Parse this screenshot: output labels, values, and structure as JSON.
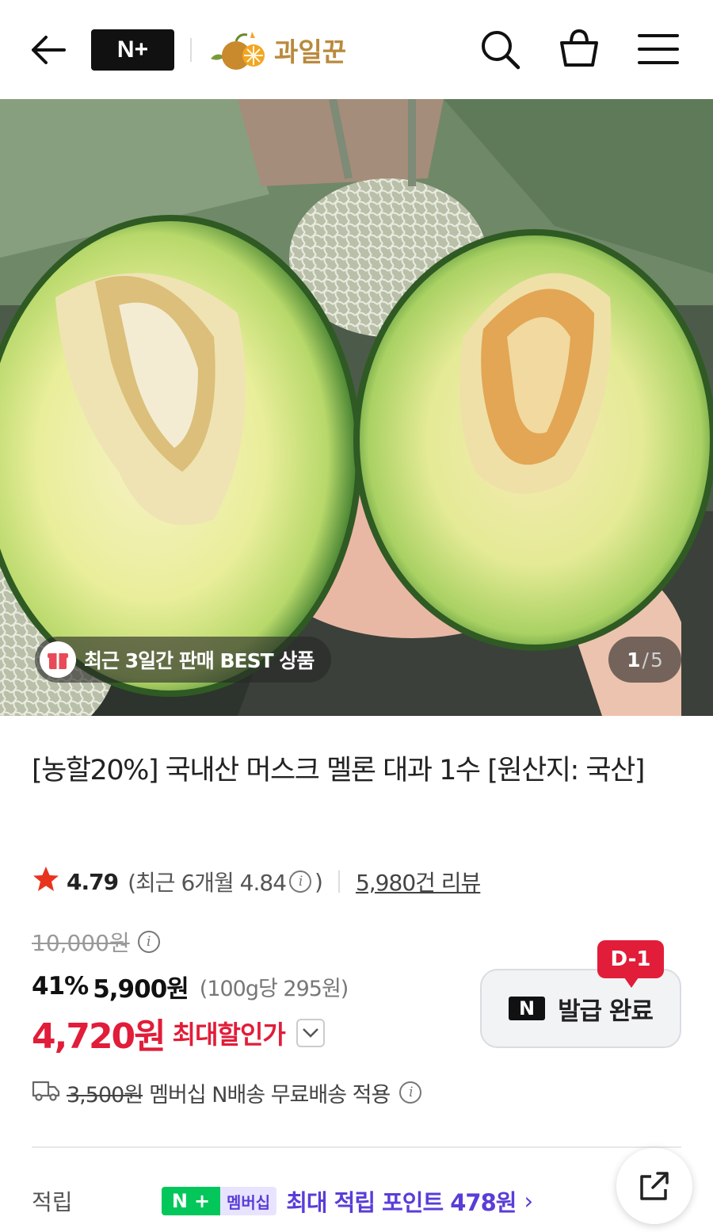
{
  "header": {
    "brand_badge": "N+",
    "store_name": "과일꾼"
  },
  "hero": {
    "badge_text": "최근 3일간 판매 BEST 상품",
    "page_current": "1",
    "page_sep": "/",
    "page_total": "5"
  },
  "product": {
    "title": "[농할20%] 국내산 머스크 멜론 대과 1수 [원산지: 국산]",
    "rating": "4.79",
    "recent_rating_label": "(최근 6개월 4.84",
    "recent_rating_close": ")",
    "review_count": "5,980건 리뷰",
    "original_price": "10,000원",
    "discount_rate": "41%",
    "discount_price": "5,900원",
    "unit_price": "(100g당 295원)",
    "final_price": "4,720원",
    "final_price_label": "최대할인가"
  },
  "coupon": {
    "dday": "D-1",
    "n_mark": "N",
    "label": "발급 완료"
  },
  "shipping": {
    "original_fee": "3,500원",
    "text": "멤버십 N배송 무료배송 적용"
  },
  "points": {
    "label": "적립",
    "badge_n": "N",
    "badge_plus": "+",
    "badge_membership": "멤버십",
    "text": "최대 적립 포인트 478원",
    "chevron": "›"
  },
  "colors": {
    "accent_red": "#e11d39",
    "naver_green": "#03c75a",
    "points_purple": "#5a3dd8",
    "store_gold": "#b98a3d"
  }
}
